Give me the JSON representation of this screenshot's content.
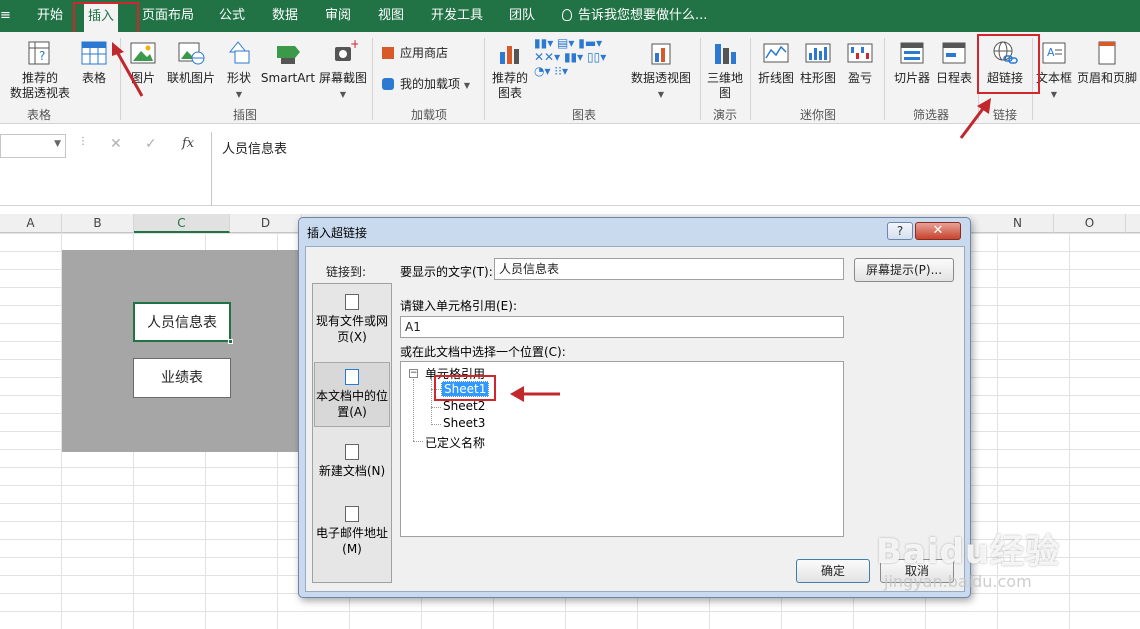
{
  "tabs": [
    {
      "label": "开始"
    },
    {
      "label": "插入"
    },
    {
      "label": "页面布局"
    },
    {
      "label": "公式"
    },
    {
      "label": "数据"
    },
    {
      "label": "审阅"
    },
    {
      "label": "视图"
    },
    {
      "label": "开发工具"
    },
    {
      "label": "团队"
    }
  ],
  "active_tab": "插入",
  "tell_me": "告诉我您想要做什么...",
  "ribbon": {
    "recommended_pivot": "推荐的\n数据透视表",
    "table": "表格",
    "picture": "图片",
    "online_picture": "联机图片",
    "shapes": "形状",
    "smartart": "SmartArt",
    "screenshot": "屏幕截图",
    "app_store": "应用商店",
    "my_addins": "我的加载项",
    "recommended_charts": "推荐的\n图表",
    "pivot_chart": "数据透视图",
    "map_3d": "三维地\n图",
    "line": "折线图",
    "column": "柱形图",
    "winloss": "盈亏",
    "slicer": "切片器",
    "timeline": "日程表",
    "hyperlink": "超链接",
    "textbox": "文本框",
    "header_footer": "页眉和页脚",
    "groups": {
      "tables": "表格",
      "illustrations": "插图",
      "addins": "加载项",
      "charts": "图表",
      "tours": "演示",
      "sparklines": "迷你图",
      "filters": "筛选器",
      "links": "链接"
    }
  },
  "formula_bar": {
    "cancel": "✕",
    "enter": "✓",
    "fx": "fx",
    "content": "人员信息表"
  },
  "columns": [
    "A",
    "B",
    "C",
    "D",
    "N",
    "O"
  ],
  "sheet_buttons": {
    "people": "人员信息表",
    "performance": "业绩表"
  },
  "dialog": {
    "title": "插入超链接",
    "help": "?",
    "close": "✕",
    "link_to": "链接到:",
    "link_options": [
      {
        "label": "现有文件或网\n页(X)"
      },
      {
        "label": "本文档中的位\n置(A)"
      },
      {
        "label": "新建文档(N)"
      },
      {
        "label": "电子邮件地址\n(M)"
      }
    ],
    "display_text_label": "要显示的文字(T):",
    "display_text_value": "人员信息表",
    "screentip_button": "屏幕提示(P)...",
    "cell_ref_label": "请键入单元格引用(E):",
    "cell_ref_value": "A1",
    "place_label": "或在此文档中选择一个位置(C):",
    "tree": {
      "cell_ref_node": "单元格引用",
      "sheets": [
        "Sheet1",
        "Sheet2",
        "Sheet3"
      ],
      "selected_sheet": "Sheet1",
      "defined_names": "已定义名称"
    },
    "ok": "确定",
    "cancel": "取消"
  },
  "watermark": {
    "brand": "Baidu经验",
    "url": "jingyan.baidu.com"
  },
  "colors": {
    "excel_green": "#217346",
    "annotation_red": "#d0262c",
    "selection_blue": "#3399ff"
  }
}
